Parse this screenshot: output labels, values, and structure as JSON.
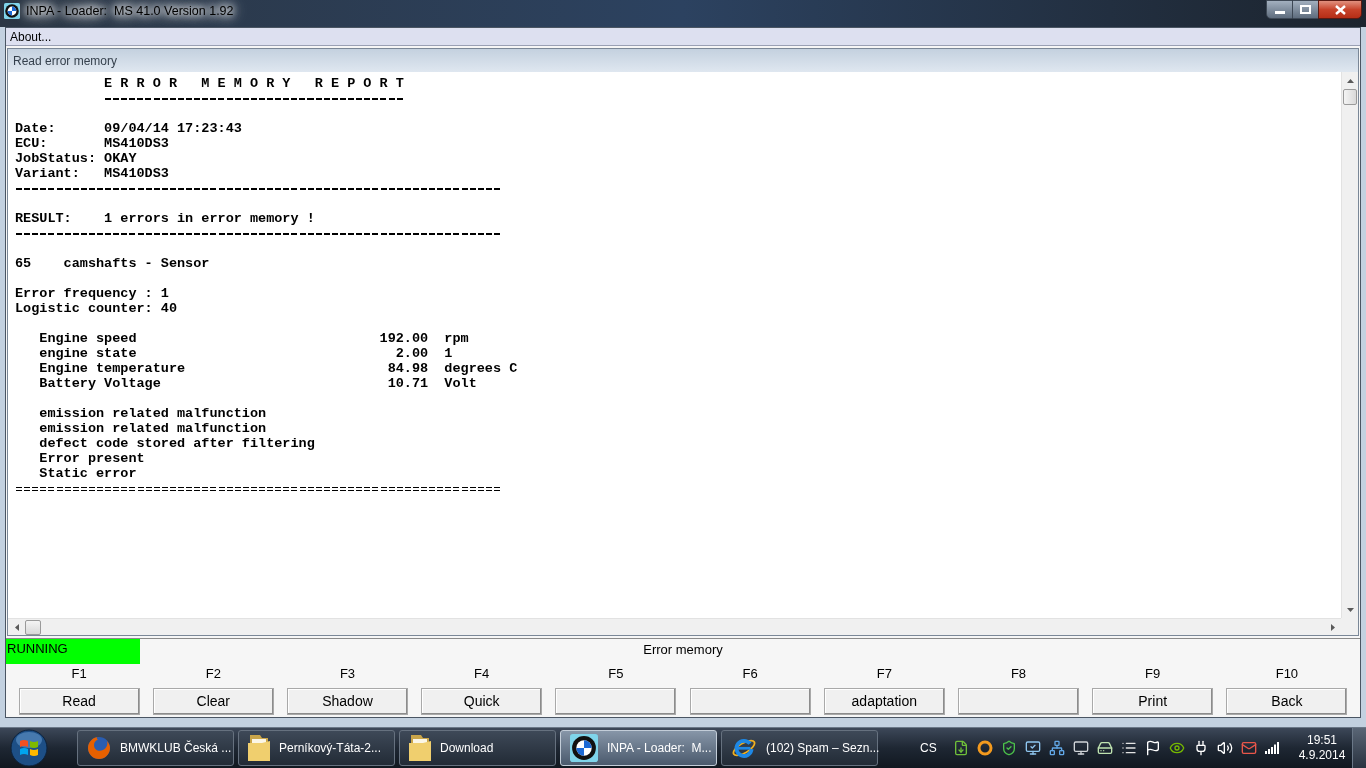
{
  "window": {
    "title": "INPA - Loader:  MS 41.0 Version 1.92"
  },
  "menu": [
    {
      "label": "About..."
    }
  ],
  "panel": {
    "title": "Read error memory"
  },
  "report": {
    "title": "E R R O R   M E M O R Y   R E P O R T",
    "fields": [
      {
        "label": "Date:",
        "value": "09/04/14 17:23:43"
      },
      {
        "label": "ECU:",
        "value": "MS410DS3"
      },
      {
        "label": "JobStatus:",
        "value": "OKAY"
      },
      {
        "label": "Variant:",
        "value": "MS410DS3"
      }
    ],
    "result": {
      "label": "RESULT:",
      "text": "1 errors in error memory !"
    },
    "errors": [
      {
        "code": "65",
        "name": "camshafts - Sensor",
        "frequency": {
          "label": "Error frequency :",
          "value": "1"
        },
        "counter": {
          "label": "Logistic counter:",
          "value": "40"
        },
        "conditions": [
          {
            "name": "Engine speed",
            "value": "192.00",
            "unit": "rpm"
          },
          {
            "name": "engine state",
            "value": "2.00",
            "unit": "1"
          },
          {
            "name": "Engine temperature",
            "value": "84.98",
            "unit": "degrees C"
          },
          {
            "name": "Battery Voltage",
            "value": "10.71",
            "unit": "Volt"
          }
        ],
        "flags": [
          "emission related malfunction",
          "emission related malfunction",
          "defect code stored after filtering",
          "Error present",
          "Static error"
        ]
      }
    ]
  },
  "status": {
    "state": "RUNNING",
    "caption": "Error memory"
  },
  "function_keys": [
    {
      "key": "F1",
      "label": "Read"
    },
    {
      "key": "F2",
      "label": "Clear"
    },
    {
      "key": "F3",
      "label": "Shadow"
    },
    {
      "key": "F4",
      "label": "Quick"
    },
    {
      "key": "F5"
    },
    {
      "key": "F6"
    },
    {
      "key": "F7",
      "label": "adaptation"
    },
    {
      "key": "F8"
    },
    {
      "key": "F9",
      "label": "Print"
    },
    {
      "key": "F10",
      "label": "Back"
    }
  ],
  "taskbar": {
    "tasks": [
      {
        "label": "BMWKLUB Česká ...",
        "kind": "browser",
        "selected": false
      },
      {
        "label": "Perníkový-Táta-2...",
        "kind": "folder",
        "selected": false
      },
      {
        "label": "Download",
        "kind": "folder",
        "selected": false
      },
      {
        "label": "INPA - Loader:  M...",
        "kind": "roundel",
        "selected": true
      },
      {
        "label": "(102) Spam – Sezn...",
        "kind": "explorer",
        "selected": false
      }
    ],
    "tray": {
      "language": "CS",
      "time": "19:51",
      "date": "4.9.2014"
    }
  }
}
